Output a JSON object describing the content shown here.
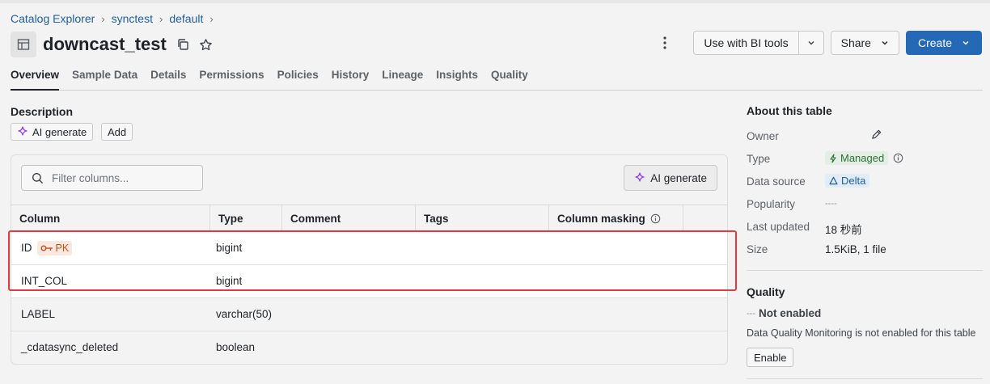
{
  "breadcrumb": {
    "items": [
      "Catalog Explorer",
      "synctest",
      "default"
    ],
    "separator": "›"
  },
  "header": {
    "title": "downcast_test",
    "bi_tools_label": "Use with BI tools",
    "share_label": "Share",
    "create_label": "Create"
  },
  "tabs": [
    "Overview",
    "Sample Data",
    "Details",
    "Permissions",
    "Policies",
    "History",
    "Lineage",
    "Insights",
    "Quality"
  ],
  "active_tab": "Overview",
  "description": {
    "label": "Description",
    "ai_generate_label": "AI generate",
    "add_label": "Add"
  },
  "columns_panel": {
    "filter_placeholder": "Filter columns...",
    "ai_generate_label": "AI generate",
    "headers": [
      "Column",
      "Type",
      "Comment",
      "Tags",
      "Column masking"
    ],
    "pk_label": "PK",
    "rows": [
      {
        "name": "ID",
        "type": "bigint",
        "pk": true
      },
      {
        "name": "INT_COL",
        "type": "bigint",
        "pk": false
      },
      {
        "name": "LABEL",
        "type": "varchar(50)",
        "pk": false
      },
      {
        "name": "_cdatasync_deleted",
        "type": "boolean",
        "pk": false
      }
    ]
  },
  "about": {
    "title": "About this table",
    "owner_label": "Owner",
    "type_label": "Type",
    "type_value": "Managed",
    "data_source_label": "Data source",
    "data_source_value": "Delta",
    "popularity_label": "Popularity",
    "popularity_value": "----",
    "last_updated_label": "Last updated",
    "last_updated_value": "18 秒前",
    "size_label": "Size",
    "size_value": "1.5KiB, 1 file"
  },
  "quality": {
    "title": "Quality",
    "status_dash": "---",
    "status": "Not enabled",
    "description": "Data Quality Monitoring is not enabled for this table",
    "enable_label": "Enable"
  },
  "colors": {
    "link": "#1e5fa8",
    "primary": "#2568b5",
    "highlight_border": "#e03a3a",
    "pk": "#c4501d",
    "managed": "#2f6e37",
    "ai_icon": "#8a3ffc"
  },
  "icons": [
    "table-icon",
    "copy-icon",
    "star-icon",
    "kebab-icon",
    "chevron-down-icon",
    "sparkle-icon",
    "search-icon",
    "key-icon",
    "info-icon",
    "pencil-icon",
    "bolt-icon",
    "delta-icon"
  ]
}
